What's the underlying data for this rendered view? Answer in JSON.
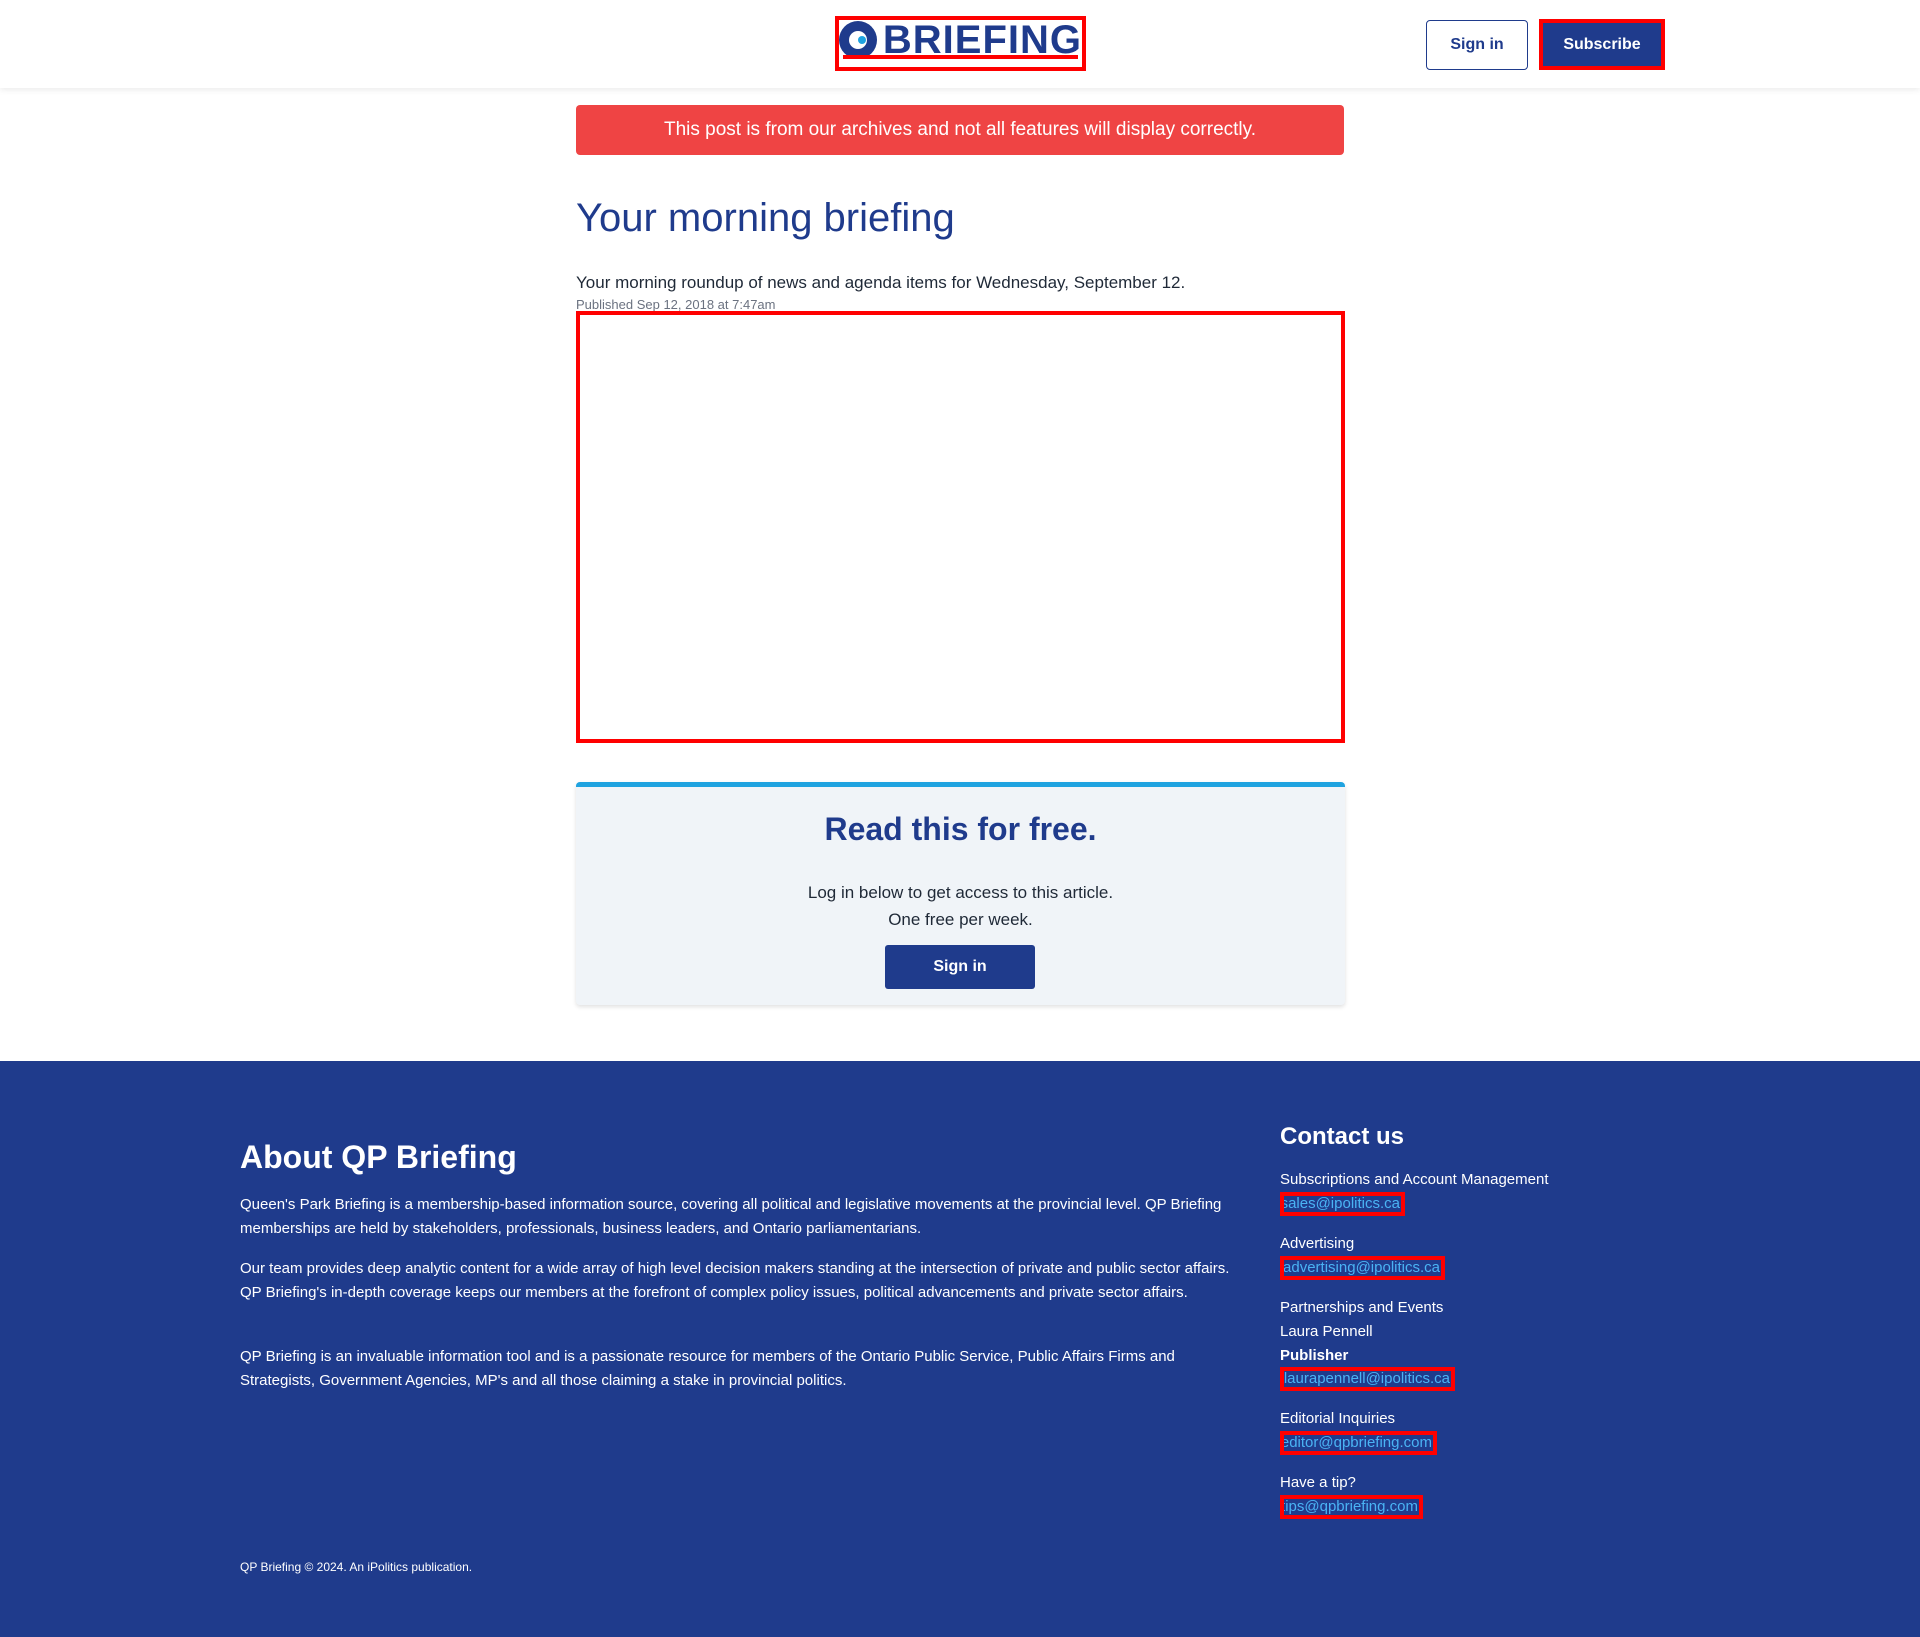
{
  "header": {
    "logo_text": "BRIEFING",
    "signin_label": "Sign in",
    "subscribe_label": "Subscribe"
  },
  "article": {
    "archive_notice": "This post is from our archives and not all features will display correctly.",
    "title": "Your morning briefing",
    "summary": "Your morning roundup of news and agenda items for Wednesday, September 12.",
    "published": "Published Sep 12, 2018 at 7:47am"
  },
  "paywall": {
    "title": "Read this for free.",
    "line1": "Log in below to get access to this article.",
    "line2": "One free per week.",
    "signin_label": "Sign in"
  },
  "footer": {
    "about_title": "About QP Briefing",
    "about_paragraphs": [
      "Queen's Park Briefing is a membership-based information source, covering all political and legislative movements at the provincial level. QP Briefing memberships are held by stakeholders, professionals, business leaders, and Ontario parliamentarians.",
      "Our team provides deep analytic content for a wide array of high level decision makers standing at the intersection of private and public sector affairs. QP Briefing's in-depth coverage keeps our members at the forefront of complex policy issues, political advancements and private sector affairs.",
      "QP Briefing is an invaluable information tool and is a passionate resource for members of the Ontario Public Service, Public Affairs Firms and Strategists, Government Agencies, MP's and all those claiming a stake in provincial politics."
    ],
    "copyright": "QP Briefing © 2024. An iPolitics publication.",
    "contact": {
      "title": "Contact us",
      "subscriptions_label": "Subscriptions and Account Management",
      "subscriptions_email": "sales@ipolitics.ca",
      "advertising_label": "Advertising",
      "advertising_email": "advertising@ipolitics.ca",
      "partnerships_label": "Partnerships and Events",
      "partnerships_name": "Laura Pennell",
      "partnerships_role": "Publisher",
      "partnerships_email": "laurapennell@ipolitics.ca",
      "editorial_label": "Editorial Inquiries",
      "editorial_email": "editor@qpbriefing.com",
      "tip_label": "Have a tip?",
      "tip_email": "tips@qpbriefing.com"
    }
  },
  "colors": {
    "brand_navy": "#1f3b8c",
    "accent_blue": "#1fa3e0",
    "alert_red": "#ef4444",
    "link_blue": "#4ab3f4"
  }
}
